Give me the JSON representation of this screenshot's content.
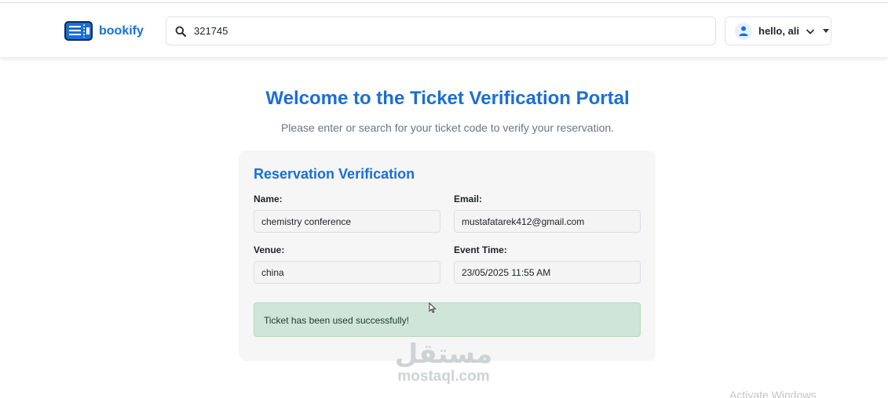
{
  "header": {
    "brand_name": "bookify",
    "search": {
      "value": "321745",
      "icon": "search-icon"
    },
    "user_menu": {
      "label": "hello, ali",
      "icon": "user-icon"
    }
  },
  "hero": {
    "title": "Welcome to the Ticket Verification Portal",
    "subtitle": "Please enter or search for your ticket code to verify your reservation."
  },
  "card": {
    "title": "Reservation Verification",
    "fields": [
      {
        "label": "Name:",
        "value": "chemistry conference"
      },
      {
        "label": "Email:",
        "value": "mustafatarek412@gmail.com"
      },
      {
        "label": "Venue:",
        "value": "china"
      },
      {
        "label": "Event Time:",
        "value": "23/05/2025 11:55 AM"
      }
    ],
    "alert": "Ticket has been used successfully!"
  },
  "watermark": {
    "arabic": "مستقل",
    "latin": "mostaql.com"
  },
  "os_notice": "Activate Windows",
  "colors": {
    "accent": "#1a6fd6",
    "success_bg": "#cfe5d8",
    "card_bg": "#f5f6f5"
  }
}
